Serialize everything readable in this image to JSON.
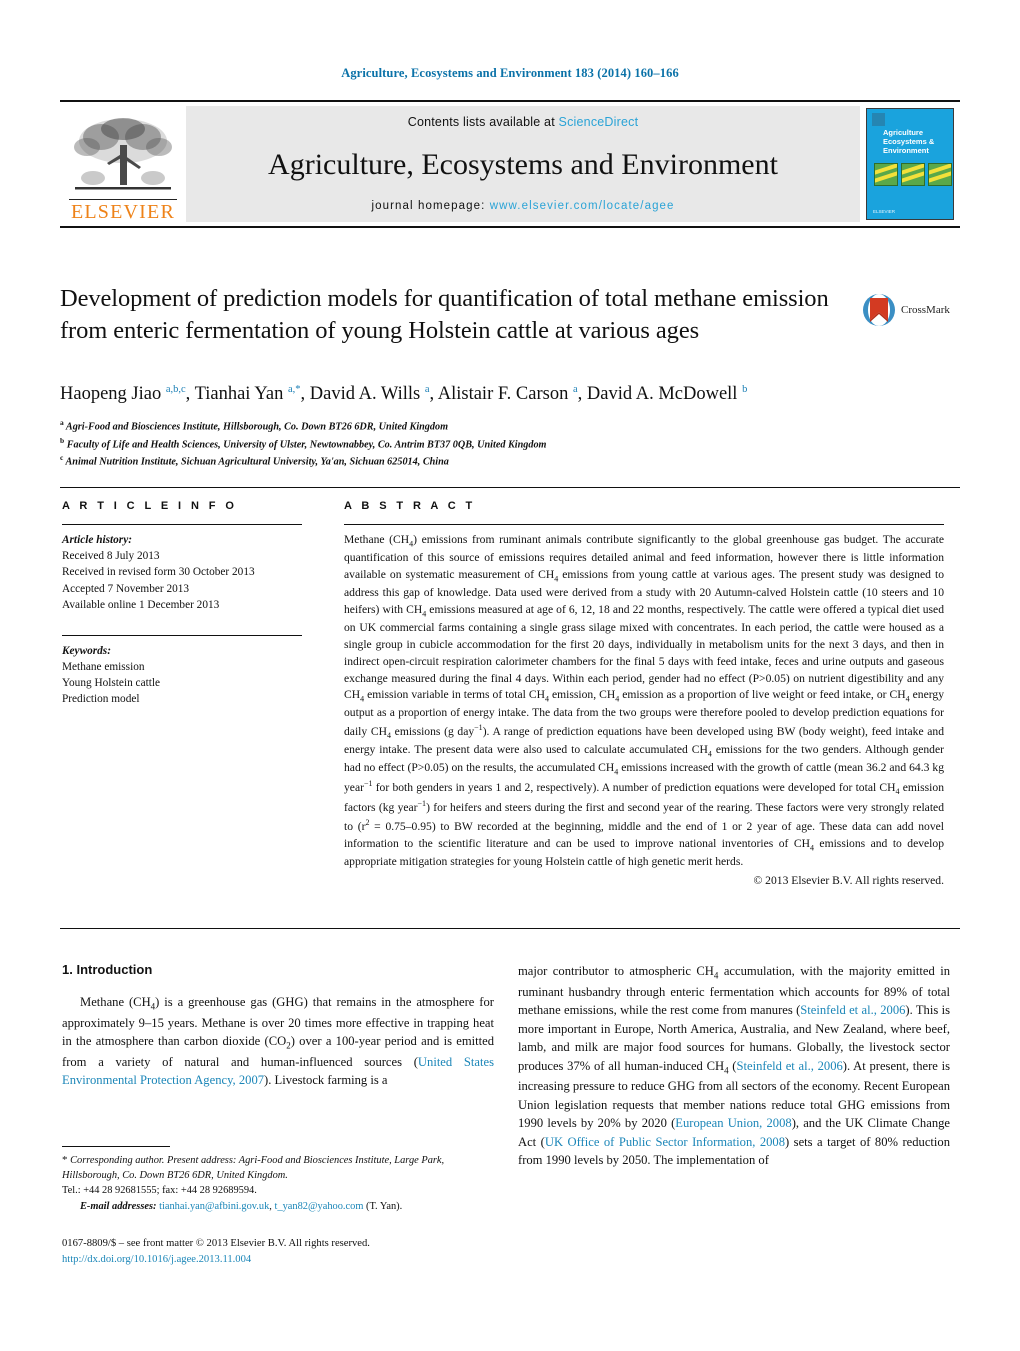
{
  "running_head": "Agriculture, Ecosystems and Environment 183 (2014) 160–166",
  "masthead": {
    "publisher_name": "ELSEVIER",
    "contents_prefix": "Contents lists available at ",
    "contents_link": "ScienceDirect",
    "journal_name": "Agriculture, Ecosystems and Environment",
    "homepage_prefix": "journal homepage: ",
    "homepage_url": "www.elsevier.com/locate/agee",
    "cover": {
      "title_line1": "Agriculture",
      "title_line2": "Ecosystems &",
      "title_line3": "Environment",
      "footer": "ELSEVIER"
    }
  },
  "article": {
    "title": "Development of prediction models for quantification of total methane emission from enteric fermentation of young Holstein cattle at various ages",
    "crossmark_label": "CrossMark",
    "authors_html": "Haopeng Jiao <sup>a,b,c</sup>, Tianhai Yan <sup>a,<span class=\"star\">*</span></sup>, David A. Wills <sup>a</sup>, Alistair F. Carson <sup>a</sup>, David A. McDowell <sup>b</sup>",
    "affiliations": [
      {
        "marker": "a",
        "text": "Agri-Food and Biosciences Institute, Hillsborough, Co. Down BT26 6DR, United Kingdom"
      },
      {
        "marker": "b",
        "text": "Faculty of Life and Health Sciences, University of Ulster, Newtownabbey, Co. Antrim BT37 0QB, United Kingdom"
      },
      {
        "marker": "c",
        "text": "Animal Nutrition Institute, Sichuan Agricultural University, Ya'an, Sichuan 625014, China"
      }
    ]
  },
  "article_info": {
    "heading": "A R T I C L E   I N F O",
    "history_label": "Article history:",
    "history": [
      "Received 8 July 2013",
      "Received in revised form 30 October 2013",
      "Accepted 7 November 2013",
      "Available online 1 December 2013"
    ],
    "keywords_label": "Keywords:",
    "keywords": [
      "Methane emission",
      "Young Holstein cattle",
      "Prediction model"
    ]
  },
  "abstract": {
    "heading": "A B S T R A C T",
    "text_html": "Methane (CH<sub>4</sub>) emissions from ruminant animals contribute significantly to the global greenhouse gas budget. The accurate quantification of this source of emissions requires detailed animal and feed information, however there is little information available on systematic measurement of CH<sub>4</sub> emissions from young cattle at various ages. The present study was designed to address this gap of knowledge. Data used were derived from a study with 20 Autumn-calved Holstein cattle (10 steers and 10 heifers) with CH<sub>4</sub> emissions measured at age of 6, 12, 18 and 22 months, respectively. The cattle were offered a typical diet used on UK commercial farms containing a single grass silage mixed with concentrates. In each period, the cattle were housed as a single group in cubicle accommodation for the first 20 days, individually in metabolism units for the next 3 days, and then in indirect open-circuit respiration calorimeter chambers for the final 5 days with feed intake, feces and urine outputs and gaseous exchange measured during the final 4 days. Within each period, gender had no effect (P&gt;0.05) on nutrient digestibility and any CH<sub>4</sub> emission variable in terms of total CH<sub>4</sub> emission, CH<sub>4</sub> emission as a proportion of live weight or feed intake, or CH<sub>4</sub> energy output as a proportion of energy intake. The data from the two groups were therefore pooled to develop prediction equations for daily CH<sub>4</sub> emissions (g day<sup>−1</sup>). A range of prediction equations have been developed using BW (body weight), feed intake and energy intake. The present data were also used to calculate accumulated CH<sub>4</sub> emissions for the two genders. Although gender had no effect (P&gt;0.05) on the results, the accumulated CH<sub>4</sub> emissions increased with the growth of cattle (mean 36.2 and 64.3 kg year<sup>−1</sup> for both genders in years 1 and 2, respectively). A number of prediction equations were developed for total CH<sub>4</sub> emission factors (kg year<sup>−1</sup>) for heifers and steers during the first and second year of the rearing. These factors were very strongly related to (r<sup>2</sup> = 0.75–0.95) to BW recorded at the beginning, middle and the end of 1 or 2 year of age. These data can add novel information to the scientific literature and can be used to improve national inventories of CH<sub>4</sub> emissions and to develop appropriate mitigation strategies for young Holstein cattle of high genetic merit herds.",
    "copyright": "© 2013 Elsevier B.V. All rights reserved."
  },
  "body": {
    "section_heading": "1.  Introduction",
    "left_paragraph_html": "Methane (CH<sub>4</sub>) is a greenhouse gas (GHG) that remains in the atmosphere for approximately 9–15 years. Methane is over 20 times more effective in trapping heat in the atmosphere than carbon dioxide (CO<sub>2</sub>) over a 100-year period and is emitted from a variety of natural and human-influenced sources (<span class=\"cite\">United States Environmental Protection Agency, 2007</span>). Livestock farming is a",
    "right_paragraph_html": "major contributor to atmospheric CH<sub>4</sub> accumulation, with the majority emitted in ruminant husbandry through enteric fermentation which accounts for 89% of total methane emissions, while the rest come from manures (<span class=\"cite\">Steinfeld et al., 2006</span>). This is more important in Europe, North America, Australia, and New Zealand, where beef, lamb, and milk are major food sources for humans. Globally, the livestock sector produces 37% of all human-induced CH<sub>4</sub> (<span class=\"cite\">Steinfeld et al., 2006</span>). At present, there is increasing pressure to reduce GHG from all sectors of the economy. Recent European Union legislation requests that member nations reduce total GHG emissions from 1990 levels by 20% by 2020 (<span class=\"cite\">European Union, 2008</span>), and the UK Climate Change Act (<span class=\"cite\">UK Office of Public Sector Information, 2008</span>) sets a target of 80% reduction from 1990 levels by 2050. The implementation of"
  },
  "footnote": {
    "text_html": "<span style=\"font-size:11px\">*</span> <span class=\"ital\">Corresponding author. Present address: Agri-Food and Biosciences Institute, Large Park, Hillsborough, Co. Down BT26 6DR, United Kingdom.</span><br>Tel.: +44 28 92681555; fax: +44 28 92689594.",
    "email_html": "<span class=\"bld-ital\">E-mail addresses:</span> <span class=\"link\">tianhai.yan@afbini.gov.uk</span>, <span class=\"link\">t_yan82@yahoo.com</span> (T. Yan)."
  },
  "issn": {
    "line1": "0167-8809/$ – see front matter © 2013 Elsevier B.V. All rights reserved.",
    "doi": "http://dx.doi.org/10.1016/j.agee.2013.11.004"
  },
  "colors": {
    "link": "#1b86b8",
    "sciencedirect": "#2aa3d6",
    "elsevier_orange": "#ee8218",
    "cover_blue": "#1aa3dd",
    "running_head": "#0b72a8"
  }
}
